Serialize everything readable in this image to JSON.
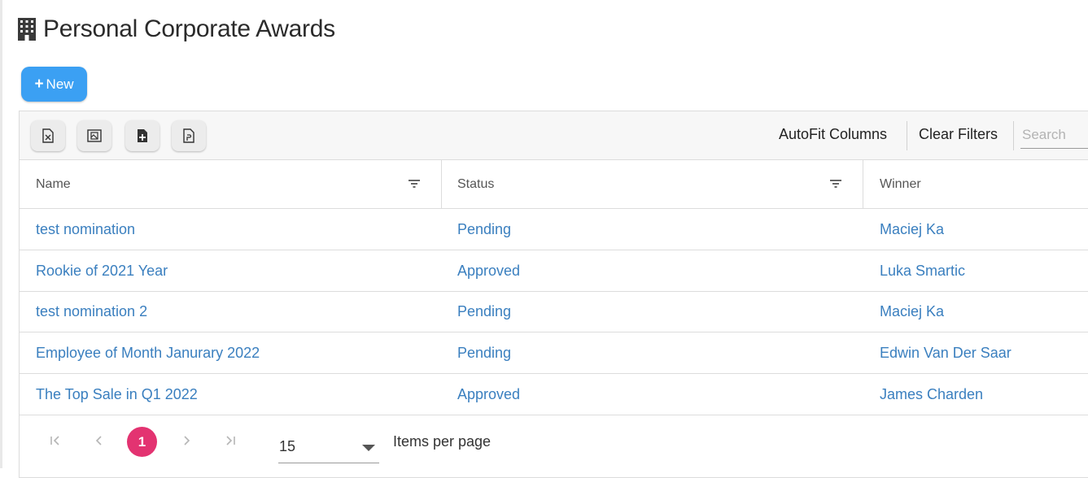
{
  "page": {
    "title": "Personal Corporate Awards",
    "title_icon": "office-building-icon"
  },
  "actions": {
    "new_label": "New",
    "new_icon": "plus-icon"
  },
  "toolbar": {
    "icon_buttons": [
      "excel-export-icon",
      "image-export-icon",
      "file-add-icon",
      "pdf-export-icon"
    ],
    "autofit_label": "AutoFit Columns",
    "clear_filters_label": "Clear Filters",
    "search_placeholder": "Search"
  },
  "columns": [
    "Name",
    "Status",
    "Winner"
  ],
  "rows": [
    {
      "name": "test nomination",
      "status": "Pending",
      "winner": "Maciej Ka"
    },
    {
      "name": "Rookie of 2021 Year",
      "status": "Approved",
      "winner": "Luka Smartic"
    },
    {
      "name": "test nomination 2",
      "status": "Pending",
      "winner": "Maciej Ka"
    },
    {
      "name": "Employee of Month Janurary 2022",
      "status": "Pending",
      "winner": "Edwin Van Der Saar"
    },
    {
      "name": "The Top Sale in Q1 2022",
      "status": "Approved",
      "winner": "James Charden"
    }
  ],
  "pagination": {
    "current_page": "1",
    "per_page": "15",
    "per_page_label": "Items per page"
  },
  "colors": {
    "primary_button": "#3ba0f3",
    "link_text": "#3a7fbf",
    "active_page": "#e33371"
  }
}
